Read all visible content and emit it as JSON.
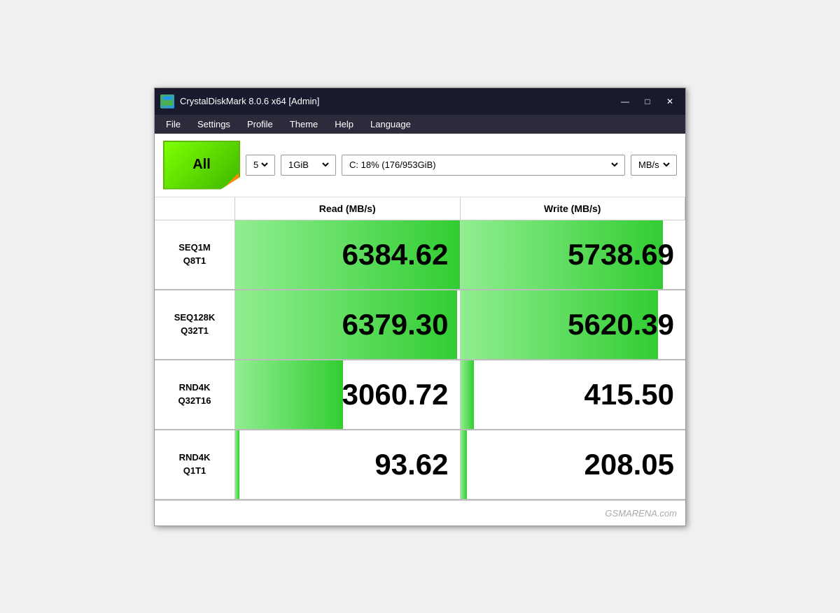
{
  "window": {
    "title": "CrystalDiskMark 8.0.6 x64 [Admin]",
    "icon_label": "CDM"
  },
  "title_controls": {
    "minimize": "—",
    "maximize": "□",
    "close": "✕"
  },
  "menu": {
    "items": [
      "File",
      "Settings",
      "Profile",
      "Theme",
      "Help",
      "Language"
    ]
  },
  "toolbar": {
    "all_label": "All",
    "runs_value": "5",
    "size_value": "1GiB",
    "drive_value": "C: 18% (176/953GiB)",
    "unit_value": "MB/s"
  },
  "columns": {
    "label": "",
    "read": "Read (MB/s)",
    "write": "Write (MB/s)"
  },
  "rows": [
    {
      "label_line1": "SEQ1M",
      "label_line2": "Q8T1",
      "read_value": "6384.62",
      "write_value": "5738.69",
      "read_pct": 100,
      "write_pct": 90
    },
    {
      "label_line1": "SEQ128K",
      "label_line2": "Q32T1",
      "read_value": "6379.30",
      "write_value": "5620.39",
      "read_pct": 99,
      "write_pct": 88
    },
    {
      "label_line1": "RND4K",
      "label_line2": "Q32T16",
      "read_value": "3060.72",
      "write_value": "415.50",
      "read_pct": 48,
      "write_pct": 6
    },
    {
      "label_line1": "RND4K",
      "label_line2": "Q1T1",
      "read_value": "93.62",
      "write_value": "208.05",
      "read_pct": 2,
      "write_pct": 3
    }
  ],
  "footer": {
    "watermark": "GSMARENA.com"
  }
}
